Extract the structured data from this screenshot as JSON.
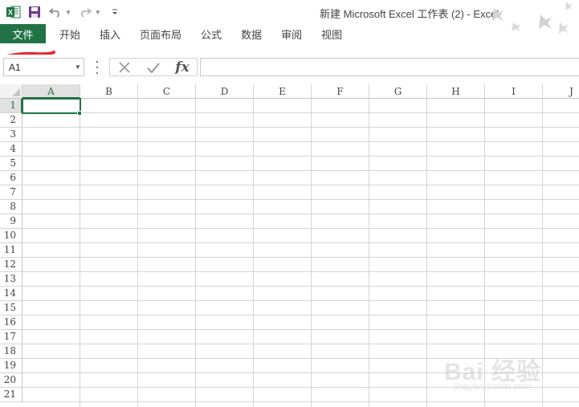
{
  "window": {
    "title": "新建 Microsoft Excel 工作表 (2) - Excel"
  },
  "quick_access": {
    "icons": [
      "excel-logo-icon",
      "save-icon",
      "undo-icon",
      "redo-icon",
      "customize-qat-icon"
    ]
  },
  "ribbon": {
    "tabs": [
      {
        "label": "文件"
      },
      {
        "label": "开始"
      },
      {
        "label": "插入"
      },
      {
        "label": "页面布局"
      },
      {
        "label": "公式"
      },
      {
        "label": "数据"
      },
      {
        "label": "审阅"
      },
      {
        "label": "视图"
      }
    ]
  },
  "formula_bar": {
    "name_box": "A1",
    "formula": "",
    "fx_label": "fx"
  },
  "sheet": {
    "columns": [
      "A",
      "B",
      "C",
      "D",
      "E",
      "F",
      "G",
      "H",
      "I",
      "J"
    ],
    "rows": [
      "1",
      "2",
      "3",
      "4",
      "5",
      "6",
      "7",
      "8",
      "9",
      "10",
      "11",
      "12",
      "13",
      "14",
      "15",
      "16",
      "17",
      "18",
      "19",
      "20",
      "21"
    ],
    "active_cell": "A1"
  },
  "watermark": {
    "text": "Bai 经验",
    "sub": "jingyan.baidu.com"
  },
  "colors": {
    "accent": "#217346",
    "annotation": "#e8262b"
  }
}
